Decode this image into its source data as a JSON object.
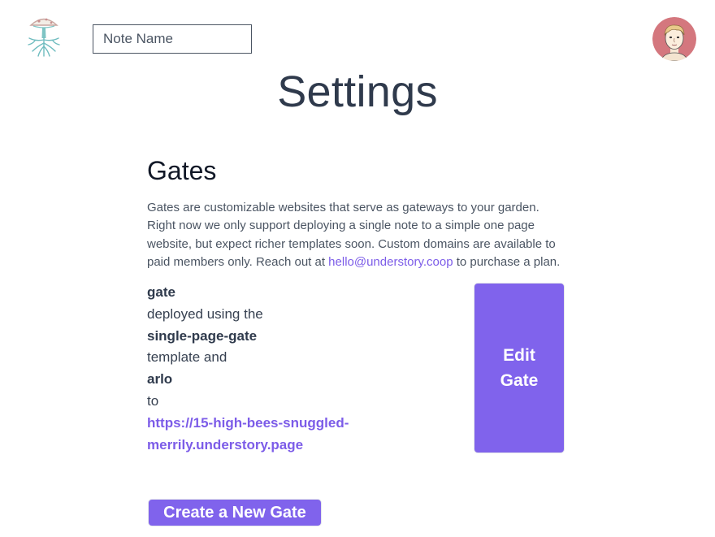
{
  "header": {
    "logo_icon": "mushroom-roots-logo-icon",
    "note_name_placeholder": "Note Name",
    "note_name_value": "",
    "avatar_icon": "user-avatar"
  },
  "page": {
    "title": "Settings"
  },
  "gates": {
    "heading": "Gates",
    "description_before_link": "Gates are customizable websites that serve as gateways to your garden. Right now we only support deploying a single note to a simple one page website, but expect richer templates soon. Custom domains are available to paid members only. Reach out at ",
    "contact_email": "hello@understory.coop",
    "description_after_link": " to purchase a plan.",
    "gate": {
      "name": "gate",
      "text_deployed_using": "deployed using the",
      "template_name": "single-page-gate",
      "text_template_and": "template and",
      "user": "arlo",
      "text_to": "to",
      "url": "https://15-high-bees-snuggled-merrily.understory.page"
    },
    "edit_button_label": "Edit Gate",
    "create_button_label": "Create a New Gate"
  },
  "colors": {
    "accent": "#8063ec",
    "link": "#7c5ce8",
    "title": "#2f3a4c",
    "body_text": "#4b5563"
  }
}
